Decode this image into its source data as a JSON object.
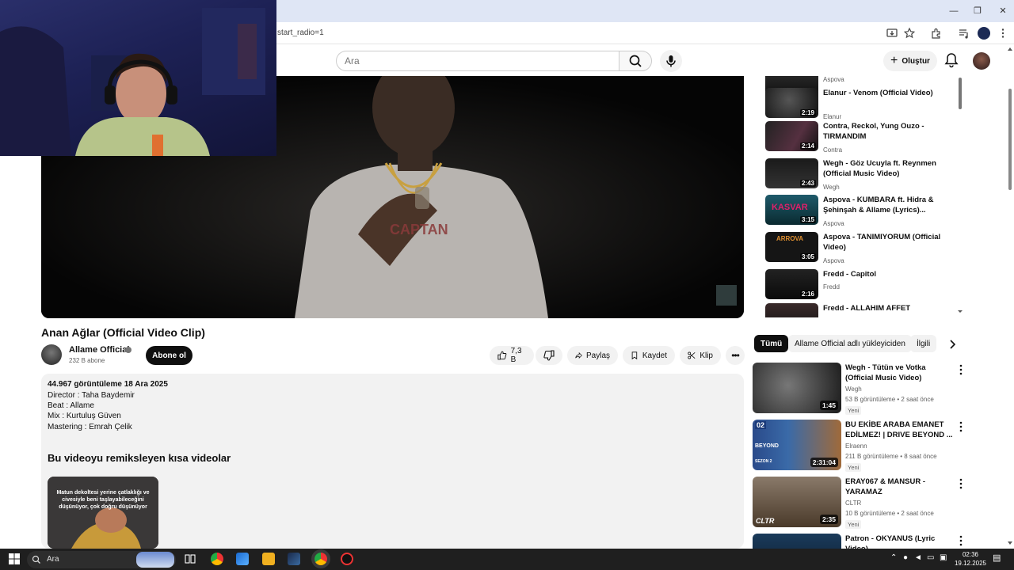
{
  "browser": {
    "url_fragment": "start_radio=1"
  },
  "header": {
    "search_placeholder": "Ara",
    "create_label": "Oluştur"
  },
  "video": {
    "title": "Anan Ağlar (Official Video Clip)",
    "channel": "Allame Official",
    "subscribers": "232 B abone",
    "subscribe_label": "Abone ol",
    "likes": "7,3 B",
    "share_label": "Paylaş",
    "save_label": "Kaydet",
    "clip_label": "Klip"
  },
  "description": {
    "stats": "44.967 görüntüleme  18 Ara 2025",
    "lines": [
      "Director : Taha Baydemir",
      "Beat : Allame",
      "Mix : Kurtuluş Güven",
      "Mastering : Emrah Çelik"
    ],
    "remix_heading": "Bu videoyu remiksleyen kısa videolar",
    "short_text": "Matun dekoltesi yerine çatlaklığı ve civesiyle beni taşlayabileceğini düşünüyor, çok doğru düşünüyor"
  },
  "playlist": [
    {
      "title": "",
      "channel": "Aspova",
      "duration": ""
    },
    {
      "title": "Elanur - Venom (Official Video)",
      "channel": "Elanur",
      "duration": "2:19"
    },
    {
      "title": "Contra, Reckol, Yung Ouzo - TIRMANDIM",
      "channel": "Contra",
      "duration": "2:14"
    },
    {
      "title": "Wegh - Göz Ucuyla ft. Reynmen (Official Music Video)",
      "channel": "Wegh",
      "duration": "2:43"
    },
    {
      "title": "Aspova - KUMBARA ft. Hidra & Şehinşah & Allame (Lyrics)...",
      "channel": "Aspova",
      "duration": "3:15"
    },
    {
      "title": "Aspova - TANIMIYORUM (Official Video)",
      "channel": "Aspova",
      "duration": "3:05"
    },
    {
      "title": "Fredd - Capitol",
      "channel": "Fredd",
      "duration": "2:16"
    },
    {
      "title": "Fredd - ALLAHIM AFFET",
      "channel": "",
      "duration": ""
    }
  ],
  "chips": [
    "Tümü",
    "Allame Official adlı yükleyiciden",
    "İlgili"
  ],
  "recommendations": [
    {
      "title": "Wegh - Tütün ve Votka (Official Music Video)",
      "channel": "Wegh",
      "meta": "53 B görüntüleme • 2 saat önce",
      "badge": "Yeni",
      "duration": "1:45"
    },
    {
      "title": "BU EKİBE ARABA EMANET EDİLMEZ! | DRIVE BEYOND ...",
      "channel": "Elraenn",
      "meta": "211 B görüntüleme • 8 saat önce",
      "badge": "Yeni",
      "duration": "2:31:04"
    },
    {
      "title": "ERAY067 & MANSUR - YARAMAZ",
      "channel": "CLTR",
      "meta": "10 B görüntüleme • 2 saat önce",
      "badge": "Yeni",
      "duration": "2:35"
    },
    {
      "title": "Patron - OKYANUS (Lyric Video)",
      "channel": "",
      "meta": "",
      "badge": "",
      "duration": ""
    }
  ],
  "thumb_text": {
    "kasvar": "KASVAR",
    "tanimiyorum": "ARROVA",
    "beyond_num": "02",
    "beyond": "BEYOND",
    "beyond_sub": "SEZON 2",
    "cltr": "CLTR"
  },
  "taskbar": {
    "search_label": "Ara",
    "time": "02:36",
    "date": "19.12.2025"
  },
  "colors": {
    "accent": "#0f0f0f",
    "chip_bg": "#f2f2f2",
    "taskbar": "#1f1f1f",
    "titlebar": "#dfe6f5"
  }
}
